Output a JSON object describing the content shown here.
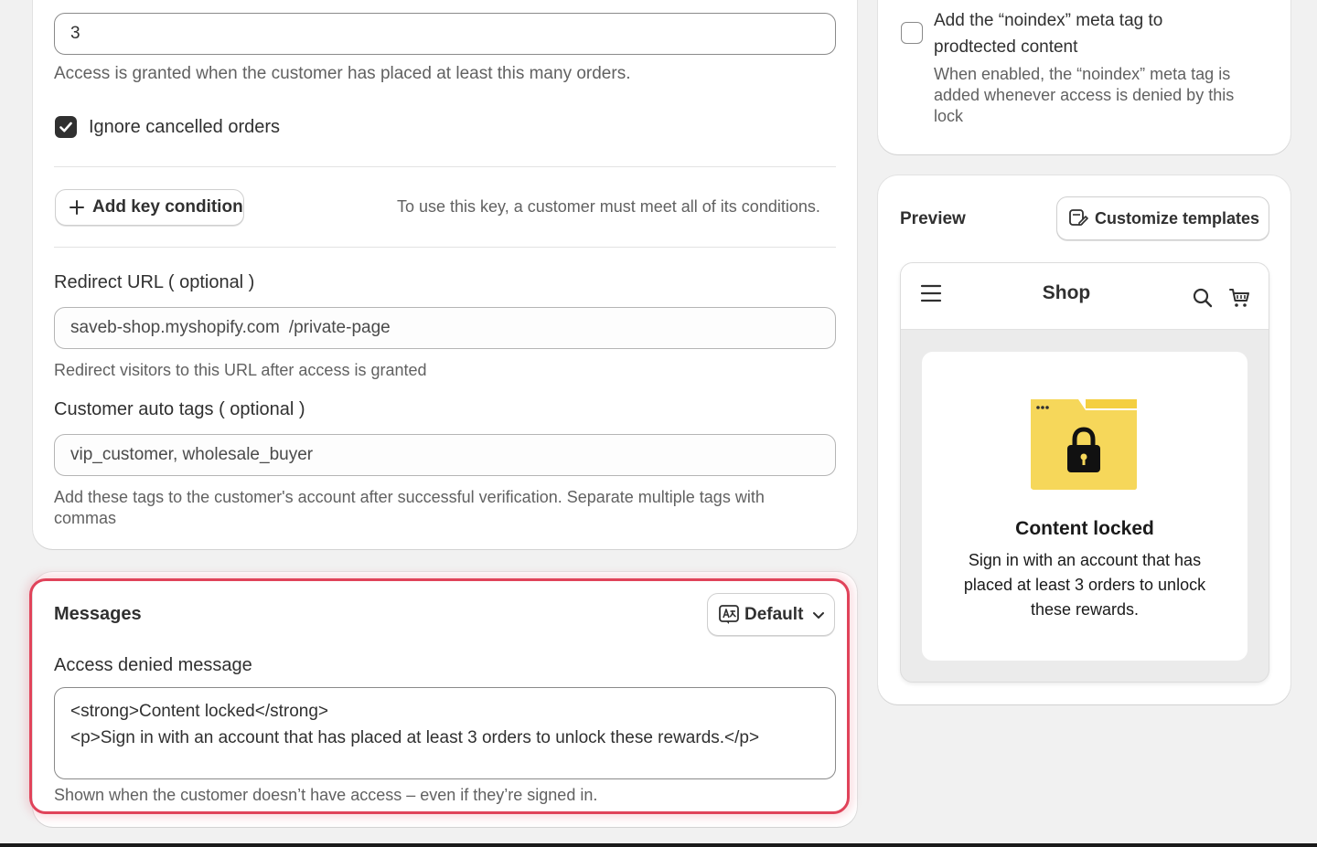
{
  "order_threshold": {
    "value": "3",
    "help": "Access is granted when the customer has placed at least this many orders."
  },
  "ignore_cancelled": {
    "label": "Ignore cancelled orders",
    "checked": true
  },
  "key_condition": {
    "button_label": "Add key condition",
    "note": "To use this key, a customer must meet all of its conditions."
  },
  "redirect": {
    "label": "Redirect URL ( optional )",
    "prefix": "saveb-shop.myshopify.com",
    "path": "/private-page",
    "help": "Redirect visitors to this URL after access is granted"
  },
  "auto_tags": {
    "label": "Customer auto tags ( optional )",
    "value": "vip_customer, wholesale_buyer",
    "help_line1": "Add these tags to the customer's account after successful verification. Separate multiple tags with",
    "help_line2": "commas"
  },
  "messages": {
    "title": "Messages",
    "language_button": "Default",
    "field_label": "Access denied message",
    "line1": "<strong>Content locked</strong>",
    "line2": "<p>Sign in with an account that has placed at least 3 orders to unlock these rewards.</p>",
    "help": "Shown when the customer doesn’t have access – even if they’re signed in."
  },
  "noindex": {
    "title_line1": "Add the “noindex” meta tag to",
    "title_line2": "prodtected content",
    "help_line1": "When enabled, the “noindex” meta tag is",
    "help_line2": "added whenever access is denied by this",
    "help_line3": "lock",
    "checked": false
  },
  "preview": {
    "title": "Preview",
    "customize_button": "Customize templates",
    "shop_name": "Shop",
    "locked_title": "Content locked",
    "locked_line1": "Sign in with an account that has",
    "locked_line2": "placed at least 3 orders to unlock",
    "locked_line3": "these rewards."
  },
  "icons": {
    "plus": "plus-icon",
    "check": "checkmark-icon",
    "translate": "translate-icon",
    "chevron": "chevron-down-icon",
    "customize": "edit-template-icon",
    "menu": "hamburger-menu-icon",
    "search": "search-icon",
    "cart": "cart-icon",
    "lock": "lock-folder-icon"
  },
  "colors": {
    "highlight": "#e0435a",
    "folder": "#f6d75a",
    "page_bg": "#f1f1f1"
  }
}
